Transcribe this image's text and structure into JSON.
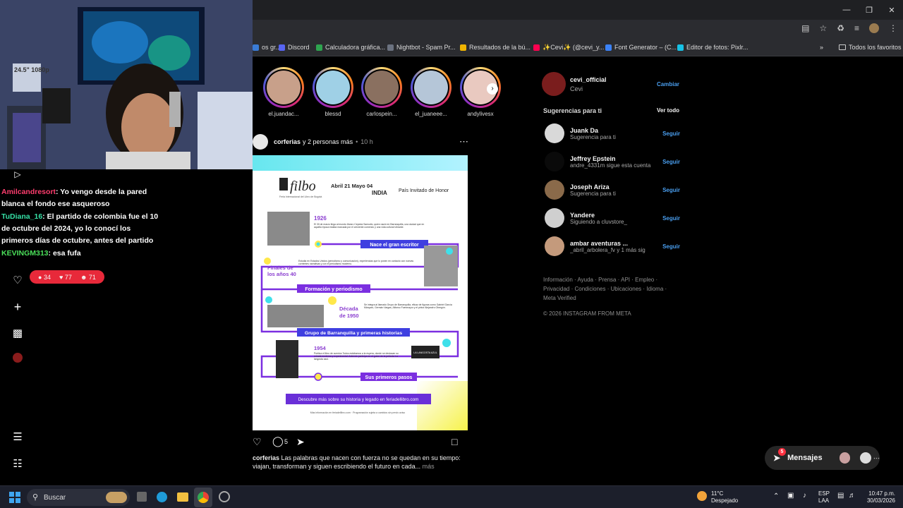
{
  "bookmarks": [
    {
      "label": "os gr...",
      "color": "#3a7bd5"
    },
    {
      "label": "Discord",
      "color": "#5865f2"
    },
    {
      "label": "Calculadora gráfica...",
      "color": "#2ea44f"
    },
    {
      "label": "Nightbot - Spam Pr...",
      "color": "#6b7280"
    },
    {
      "label": "Resultados de la bú...",
      "color": "#f0b400"
    },
    {
      "label": "✨Cevi✨ (@cevi_y...",
      "color": "#ff0050"
    },
    {
      "label": "Font Generator – (C...",
      "color": "#3b82f6"
    },
    {
      "label": "Editor de fotos: Pixlr...",
      "color": "#17c2e6"
    }
  ],
  "bookmarks_all": "Todos los favoritos",
  "stories": [
    {
      "name": "el.juandac...",
      "color": "#c8a08a"
    },
    {
      "name": "blessd",
      "color": "#9fd0e6"
    },
    {
      "name": "carlospein...",
      "color": "#8a7060"
    },
    {
      "name": "el_juaneee...",
      "color": "#b5c6d8"
    },
    {
      "name": "andylivesx",
      "color": "#e9c9c0"
    }
  ],
  "post": {
    "author": "corferias",
    "more": "y 2 personas más",
    "time": "10 h",
    "comments": "5",
    "caption_author": "corferias",
    "caption": "Las palabras que nacen con fuerza no se quedan en su tiempo: viajan, transforman y siguen escribiendo el futuro en cada...",
    "caption_more": "más",
    "image": {
      "brand": "filbo",
      "brand_sub": "Feria Internacional del Libro de Bogotá",
      "dates": "Abril 21 Mayo 04",
      "country": "INDIA",
      "guest": "País Invitado de Honor",
      "y1926": "1926",
      "t1926": "El 30 de marzo llega al mundo Álvaro Cepeda Samudio, quien nació en Barranquilla, una ciudad que en aquella época estaba marcada por el creciente comercio y una vida cultural vibrante.",
      "band1": "Nace el gran escritor",
      "y40": "Finales de los años 40",
      "t40": "Estudia en Estados Unidos (periodismo y comunicación), experiencias que lo ponen en contacto con nuevas corrientes narrativas y con el periodismo moderno.",
      "band2": "Formación y periodismo",
      "y1950": "Década de 1950",
      "t1950": "Se integra al llamado Grupo de Barranquilla, eficaz de figuras como Gabriel García Márquez, Germán Vargas, Alfonso Fuenmayor y el pintor Alejandro Obregón.",
      "band3": "Grupo de Barranquilla y primeras historias",
      "y1954": "1954",
      "t1954": "Publica el libro de cuentos Todos estábamos a la espera, donde se destacan su mirada moderna y experimental. Además participa en el guion de la película La langosta azul.",
      "book_label": "LA LANGOSTA AZUL",
      "band4": "Sus primeros pasos",
      "cta": "Descubre más sobre su historia y legado en feriadellibro.com",
      "footnote": "Más información en feriadellibro.com · Programación sujeta a cambios sin previo aviso"
    }
  },
  "profile": {
    "username": "cevi_official",
    "name": "Cevi",
    "switch": "Cambiar"
  },
  "suggestions_title": "Sugerencias para ti",
  "see_all": "Ver todo",
  "suggestions": [
    {
      "name": "Juank Da",
      "sub": "Sugerencia para ti",
      "follow": "Seguir",
      "color": "#d9d9d9"
    },
    {
      "name": "Jeffrey Epstein",
      "sub": "andre_4331m sigue esta cuenta",
      "follow": "Seguir",
      "color": "#0a0a0a"
    },
    {
      "name": "Joseph Ariza",
      "sub": "Sugerencia para ti",
      "follow": "Seguir",
      "color": "#8a6a4a"
    },
    {
      "name": "Yandere",
      "sub": "Siguiendo a cluvstore_",
      "follow": "Seguir",
      "color": "#cfcfcf"
    },
    {
      "name": "ambar aventuras ...",
      "sub": "_abril_arbolera_fv y 1 más sig",
      "follow": "Seguir",
      "color": "#c49a7c"
    }
  ],
  "footer_links": "Información · Ayuda · Prensa · API · Empleo · Privacidad · Condiciones · Ubicaciones · Idioma · Meta Verified",
  "copyright": "© 2026 INSTAGRAM FROM META",
  "messages": {
    "label": "Mensajes",
    "badge": "5"
  },
  "monitor_text": "24.5\" 1080p",
  "chat": [
    {
      "user": "Amilcandresort",
      "text": ": Yo vengo desde la pared blanca el fondo ese asqueroso",
      "color": "#ff3d6e"
    },
    {
      "user": "TuDiana_16",
      "text": ": El partido de colombia fue el 10 de octubre del 2024, yo lo conocí los primeros días de octubre, antes del partido",
      "color": "#35e0a5"
    },
    {
      "user": "KEVINGM313",
      "text": ": esa fufa",
      "color": "#4be05a"
    }
  ],
  "counter": {
    "comments": "34",
    "likes": "77",
    "viewers": "71"
  },
  "taskbar": {
    "search": "Buscar",
    "temp": "11°C",
    "weather": "Despejado",
    "lang1": "ESP",
    "lang2": "LAA",
    "time": "10:47 p.m.",
    "date": "30/03/2026"
  },
  "colors": {
    "accent_blue": "#4a9ff0",
    "live_red": "#e8293a",
    "ig_bg": "#000000"
  }
}
